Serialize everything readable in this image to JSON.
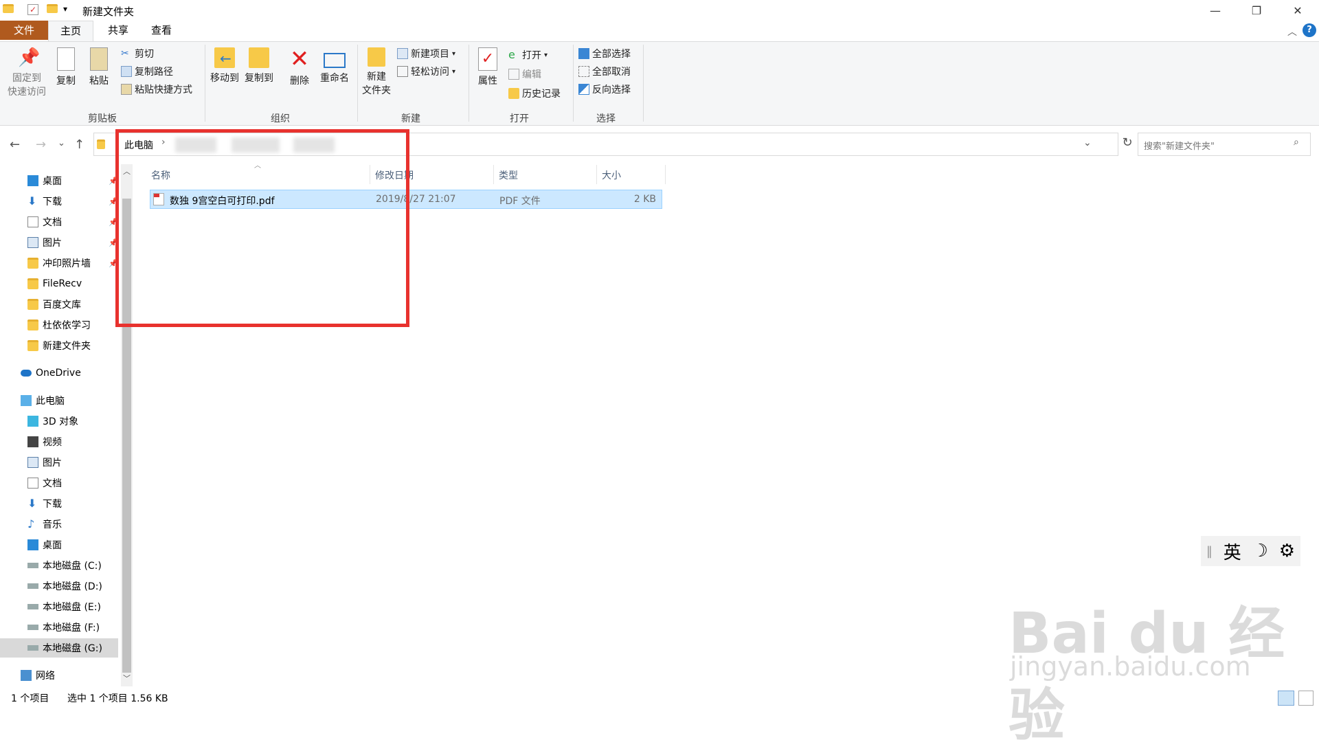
{
  "window": {
    "title": "新建文件夹",
    "qat_dropdown": "▾",
    "min": "—",
    "restore": "❐",
    "close": "✕"
  },
  "tabs": {
    "file": "文件",
    "home": "主页",
    "share": "共享",
    "view": "查看",
    "help": "?"
  },
  "ribbon": {
    "clipboard": {
      "pin": [
        "固定到",
        "快速访问"
      ],
      "copy": "复制",
      "paste": "粘贴",
      "cut": "剪切",
      "copy_path": "复制路径",
      "paste_shortcut": "粘贴快捷方式",
      "label": "剪贴板"
    },
    "organize": {
      "move_to": "移动到",
      "copy_to": "复制到",
      "delete": "删除",
      "rename": "重命名",
      "label": "组织"
    },
    "new": {
      "new_folder": [
        "新建",
        "文件夹"
      ],
      "new_item": "新建项目",
      "easy_access": "轻松访问",
      "label": "新建"
    },
    "open": {
      "properties": "属性",
      "open": "打开",
      "edit": "编辑",
      "history": "历史记录",
      "label": "打开"
    },
    "select": {
      "select_all": "全部选择",
      "select_none": "全部取消",
      "invert": "反向选择",
      "label": "选择"
    }
  },
  "address": {
    "crumb": "此电脑",
    "separator": "›",
    "back": "←",
    "forward": "→",
    "recent": "⌄",
    "up": "↑",
    "dropdown": "⌄",
    "refresh": "↻",
    "search_placeholder": "搜索\"新建文件夹\""
  },
  "nav": {
    "quick": [
      "桌面",
      "下载",
      "文档",
      "图片",
      "冲印照片墙",
      "FileRecv",
      "百度文库",
      "杜依依学习",
      "新建文件夹"
    ],
    "onedrive": "OneDrive",
    "thispc": "此电脑",
    "pc_items": [
      "3D 对象",
      "视频",
      "图片",
      "文档",
      "下载",
      "音乐",
      "桌面",
      "本地磁盘 (C:)",
      "本地磁盘 (D:)",
      "本地磁盘 (E:)",
      "本地磁盘 (F:)",
      "本地磁盘 (G:)"
    ],
    "network": "网络"
  },
  "columns": {
    "name": "名称",
    "modified": "修改日期",
    "type": "类型",
    "size": "大小"
  },
  "files": [
    {
      "name": "数独 9宫空白可打印.pdf",
      "modified": "2019/8/27 21:07",
      "type": "PDF 文件",
      "size": "2 KB"
    }
  ],
  "status": {
    "count": "1 个项目",
    "selected": "选中 1 个项目  1.56 KB"
  },
  "ime": {
    "lang": "英",
    "moon": "☽",
    "gear": "⚙"
  },
  "watermark": {
    "brand": "Bai du 经验",
    "url": "jingyan.baidu.com"
  },
  "colors": {
    "file_tab": "#b05a1e",
    "selection": "#cce8ff",
    "highlight_box": "#e8322e",
    "folder": "#f7c948"
  }
}
